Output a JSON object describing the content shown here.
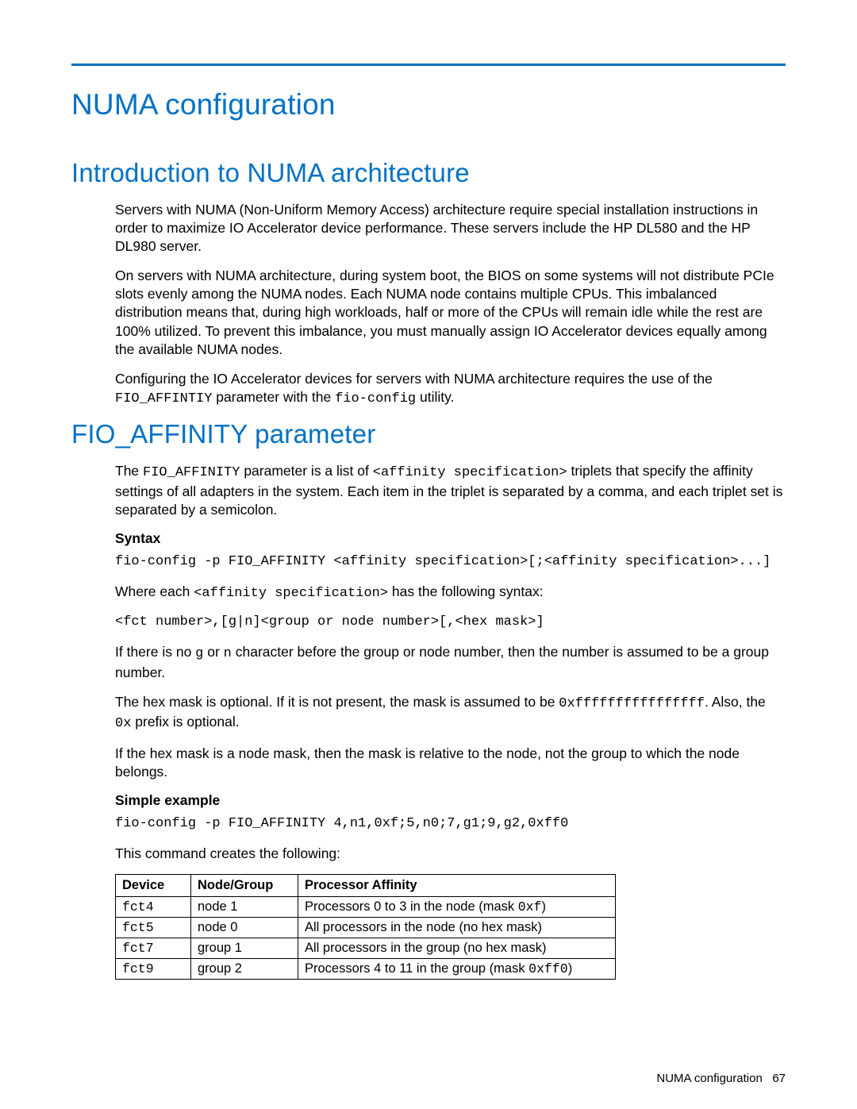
{
  "title": "NUMA configuration",
  "sections": {
    "intro": {
      "heading": "Introduction to NUMA architecture",
      "p1": "Servers with NUMA (Non-Uniform Memory Access) architecture require special installation instructions in order to maximize IO Accelerator device performance. These servers include the HP DL580 and the HP DL980 server.",
      "p2": "On servers with NUMA architecture, during system boot, the BIOS on some systems will not distribute PCIe slots evenly among the NUMA nodes. Each NUMA node contains multiple CPUs. This imbalanced distribution means that, during high workloads, half or more of the CPUs will remain idle while the rest are 100% utilized. To prevent this imbalance, you must manually assign IO Accelerator devices equally among the available NUMA nodes.",
      "p3_a": "Configuring the IO Accelerator devices for servers with NUMA architecture requires the use of the ",
      "p3_code1": "FIO_AFFINTIY",
      "p3_b": " parameter with the ",
      "p3_code2": "fio-config",
      "p3_c": " utility."
    },
    "fio": {
      "heading": "FIO_AFFINITY parameter",
      "p1_a": "The ",
      "p1_code1": "FIO_AFFINITY",
      "p1_b": " parameter is a list of ",
      "p1_code2": "<affinity specification>",
      "p1_c": " triplets that specify the affinity settings of all adapters in the system. Each item in the triplet is separated by a comma, and each triplet set is separated by a semicolon.",
      "syntax_label": "Syntax",
      "syntax_block": "fio-config -p FIO_AFFINITY <affinity specification>[;<affinity specification>...]",
      "p2_a": "Where each ",
      "p2_code": "<affinity specification>",
      "p2_b": " has the following syntax:",
      "syntax_spec": "<fct number>,[g|n]<group or node number>[,<hex mask>]",
      "p3_a": "If there is no ",
      "p3_code1": "g",
      "p3_b": " or ",
      "p3_code2": "n",
      "p3_c": " character before the group or node number, then the number is assumed to be a group number.",
      "p4_a": "The hex mask is optional. If it is not present, the mask is assumed to be ",
      "p4_code1": "0xffffffffffffffff",
      "p4_b": ". Also, the ",
      "p4_code2": "0x",
      "p4_c": " prefix is optional.",
      "p5": "If the hex mask is a node mask, then the mask is relative to the node, not the group to which the node belongs.",
      "example_label": "Simple example",
      "example_block": "fio-config -p FIO_AFFINITY 4,n1,0xf;5,n0;7,g1;9,g2,0xff0",
      "example_intro": "This command creates the following:",
      "table": {
        "headers": [
          "Device",
          "Node/Group",
          "Processor Affinity"
        ],
        "rows": [
          {
            "device": "fct4",
            "ng": "node 1",
            "pa_a": "Processors 0 to 3 in the node (mask ",
            "pa_code": "0xf",
            "pa_b": ")"
          },
          {
            "device": "fct5",
            "ng": "node 0",
            "pa_a": "All processors in the node (no hex mask)",
            "pa_code": "",
            "pa_b": ""
          },
          {
            "device": "fct7",
            "ng": "group 1",
            "pa_a": "All processors in the group (no hex mask)",
            "pa_code": "",
            "pa_b": ""
          },
          {
            "device": "fct9",
            "ng": "group 2",
            "pa_a": "Processors 4 to 11 in the group (mask ",
            "pa_code": "0xff0",
            "pa_b": ")"
          }
        ]
      }
    }
  },
  "footer": {
    "label": "NUMA configuration",
    "page": "67"
  }
}
